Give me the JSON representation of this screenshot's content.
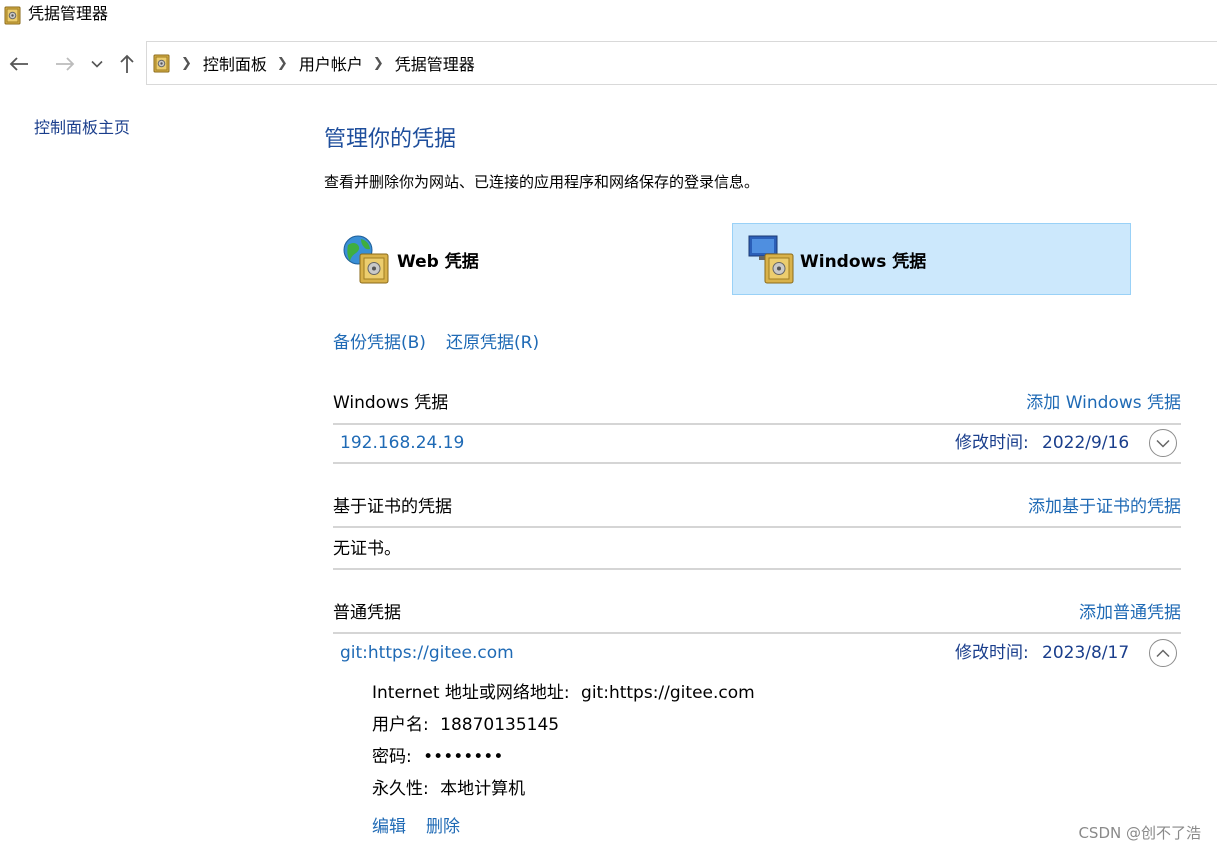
{
  "window": {
    "title": "凭据管理器",
    "icon": "vault-icon"
  },
  "nav": {
    "back_icon": "arrow-left-icon",
    "forward_icon": "arrow-right-icon",
    "recent_icon": "chevron-down-icon",
    "up_icon": "arrow-up-icon"
  },
  "breadcrumb": [
    "控制面板",
    "用户帐户",
    "凭据管理器"
  ],
  "sidebar": {
    "home_link": "控制面板主页"
  },
  "main": {
    "title": "管理你的凭据",
    "subtitle": "查看并删除你为网站、已连接的应用程序和网络保存的登录信息。",
    "tabs": [
      {
        "label": "Web 凭据",
        "icon": "globe-vault-icon",
        "selected": false
      },
      {
        "label": "Windows 凭据",
        "icon": "monitor-vault-icon",
        "selected": true
      }
    ],
    "backup_link": "备份凭据(B)",
    "restore_link": "还原凭据(R)"
  },
  "windows_credentials": {
    "title": "Windows 凭据",
    "add_link": "添加 Windows 凭据",
    "items": [
      {
        "name": "192.168.24.19",
        "modified_label": "修改时间:",
        "modified_date": "2022/9/16",
        "expanded": false
      }
    ]
  },
  "cert_credentials": {
    "title": "基于证书的凭据",
    "add_link": "添加基于证书的凭据",
    "empty_text": "无证书。"
  },
  "generic_credentials": {
    "title": "普通凭据",
    "add_link": "添加普通凭据",
    "items": [
      {
        "name": "git:https://gitee.com",
        "modified_label": "修改时间:",
        "modified_date": "2023/8/17",
        "expanded": true,
        "address_label": "Internet 地址或网络地址:",
        "address_value": "git:https://gitee.com",
        "username_label": "用户名:",
        "username_value": "18870135145",
        "password_label": "密码:",
        "password_value": "••••••••",
        "persistence_label": "永久性:",
        "persistence_value": "本地计算机",
        "edit_link": "编辑",
        "delete_link": "删除"
      }
    ]
  },
  "watermark": "CSDN @创不了浩",
  "colors": {
    "accent": "#1f6ab5",
    "title_blue": "#1e4e9c",
    "selected_tab": "#cce8fc",
    "selected_tab_border": "#99d1f7"
  }
}
